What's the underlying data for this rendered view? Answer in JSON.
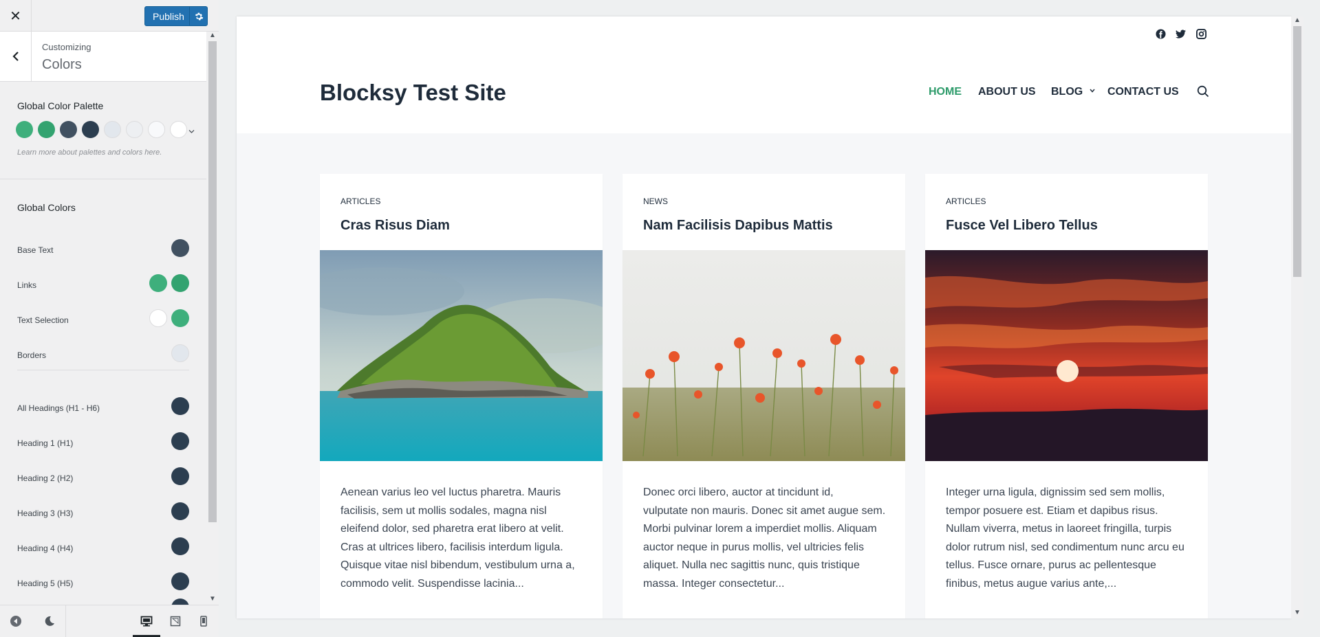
{
  "topbar": {
    "close_label": "✕",
    "publish_label": "Publish"
  },
  "section": {
    "breadcrumb": "Customizing",
    "title": "Colors"
  },
  "palette": {
    "label": "Global Color Palette",
    "hint": "Learn more about palettes and colors here.",
    "colors": [
      "#3eaf7c",
      "#33a370",
      "#415161",
      "#2c3e50",
      "#e2e7ed",
      "#edeff2",
      "#f8f9fb",
      "#ffffff"
    ]
  },
  "global_colors": {
    "label": "Global Colors",
    "rows": [
      {
        "label": "Base Text",
        "colors": [
          "#415161"
        ]
      },
      {
        "label": "Links",
        "colors": [
          "#3eaf7c",
          "#33a370"
        ]
      },
      {
        "label": "Text Selection",
        "colors": [
          "#ffffff",
          "#3eaf7c"
        ]
      },
      {
        "label": "Borders",
        "colors": [
          "#e2e7ed"
        ]
      },
      {
        "label": "All Headings (H1 - H6)",
        "colors": [
          "#2c3e50"
        ]
      },
      {
        "label": "Heading 1 (H1)",
        "colors": [
          "#2c3e50"
        ]
      },
      {
        "label": "Heading 2 (H2)",
        "colors": [
          "#2c3e50"
        ]
      },
      {
        "label": "Heading 3 (H3)",
        "colors": [
          "#2c3e50"
        ]
      },
      {
        "label": "Heading 4 (H4)",
        "colors": [
          "#2c3e50"
        ]
      },
      {
        "label": "Heading 5 (H5)",
        "colors": [
          "#2c3e50"
        ]
      }
    ]
  },
  "footer": {
    "icons": [
      "hide-controls-icon",
      "dark-mode-icon",
      "desktop-icon",
      "tablet-icon",
      "mobile-icon"
    ]
  },
  "site": {
    "title": "Blocksy Test Site",
    "social_icons": [
      "facebook-icon",
      "twitter-icon",
      "instagram-icon"
    ],
    "nav": [
      {
        "label": "HOME",
        "active": true
      },
      {
        "label": "ABOUT US"
      },
      {
        "label": "BLOG",
        "has_submenu": true
      },
      {
        "label": "CONTACT US"
      }
    ],
    "accent": "#2d9b6a",
    "heading_color": "#1e2b3a"
  },
  "posts": [
    {
      "category": "ARTICLES",
      "title": "Cras Risus Diam",
      "image": "island",
      "excerpt_lines": [
        "Aenean varius leo vel luctus pharetra. Mauris",
        "facilisis, sem ut mollis sodales, magna nisl",
        "eleifend dolor, sed pharetra erat libero at velit.",
        "Cras at ultrices libero, facilisis interdum ligula.",
        "Quisque vitae nisl bibendum, vestibulum urna a,",
        "commodo velit. Suspendisse lacinia..."
      ]
    },
    {
      "category": "NEWS",
      "title": "Nam Facilisis Dapibus Mattis",
      "image": "poppies",
      "excerpt_lines": [
        "Donec orci libero, auctor at tincidunt id,",
        "vulputate non mauris. Donec sit amet augue sem.",
        "Morbi pulvinar lorem a imperdiet mollis. Aliquam",
        "auctor neque in purus mollis, vel ultricies felis",
        "aliquet. Nulla nec sagittis nunc, quis tristique",
        "massa. Integer consectetur..."
      ]
    },
    {
      "category": "ARTICLES",
      "title": "Fusce Vel Libero Tellus",
      "image": "sunset",
      "excerpt_lines": [
        "Integer urna ligula, dignissim sed sem mollis,",
        "tempor posuere est. Etiam et dapibus risus.",
        "Nullam viverra, metus in laoreet fringilla, turpis",
        "dolor rutrum nisl, sed condimentum nunc arcu eu",
        "tellus. Fusce ornare, purus ac pellentesque",
        "finibus, metus augue varius ante,..."
      ]
    }
  ]
}
